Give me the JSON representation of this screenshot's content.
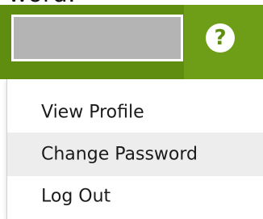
{
  "header": {
    "partial_text": "word:",
    "help_icon": "question-mark-icon",
    "bar_color": "#5f8d10",
    "accent_color": "#6e9e17"
  },
  "menu": {
    "items": [
      {
        "label": "View Profile"
      },
      {
        "label": "Change Password",
        "highlighted": true
      },
      {
        "label": "Log Out"
      }
    ]
  }
}
